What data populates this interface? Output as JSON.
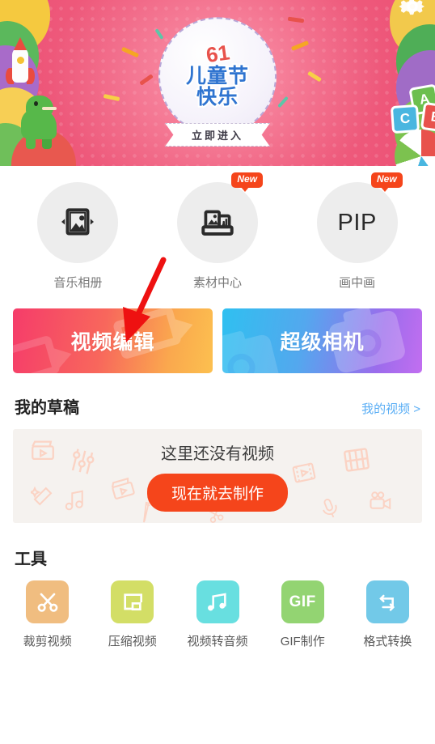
{
  "banner": {
    "name": "children-day-banner",
    "badge_number": "61",
    "title_line1": "儿童节",
    "title_line2": "快乐",
    "cta_label": "立即进入",
    "background_color": "#ef5f7f",
    "title_color": "#2f74d0",
    "number_color": "#e8524c",
    "blocks": [
      "A",
      "B",
      "C"
    ]
  },
  "features": [
    {
      "label": "音乐相册",
      "icon": "photo-album-icon",
      "badge": ""
    },
    {
      "label": "素材中心",
      "icon": "material-box-icon",
      "badge": "New"
    },
    {
      "label": "画中画",
      "icon": "pip-text-icon",
      "badge": "New",
      "text": "PIP"
    }
  ],
  "actions": [
    {
      "label": "视频编辑",
      "icon": "film-icon",
      "gradient_from": "#f53c6a",
      "gradient_to": "#fcc04f"
    },
    {
      "label": "超级相机",
      "icon": "camera-icon",
      "gradient_from": "#2fc0f0",
      "gradient_to": "#c26ef0"
    }
  ],
  "drafts": {
    "section_title": "我的草稿",
    "link_label": "我的视频 >",
    "link_color": "#5aaef5",
    "empty_text": "这里还没有视频",
    "button_label": "现在就去制作",
    "button_color": "#f5451b",
    "card_background": "#f5f2ef"
  },
  "tools": {
    "section_title": "工具",
    "items": [
      {
        "label": "裁剪视频",
        "icon": "scissors-icon",
        "color": "#f0bd80"
      },
      {
        "label": "压缩视频",
        "icon": "compress-icon",
        "color": "#d3de66"
      },
      {
        "label": "视频转音频",
        "icon": "music-notes-icon",
        "color": "#68dfe0"
      },
      {
        "label": "GIF制作",
        "icon": "gif-text-icon",
        "color": "#93d472",
        "text": "GIF"
      },
      {
        "label": "格式转换",
        "icon": "format-convert-icon",
        "color": "#72c9e8"
      }
    ]
  },
  "annotation": {
    "arrow": "red-arrow-pointing-to-video-edit",
    "color": "#ee1111"
  }
}
